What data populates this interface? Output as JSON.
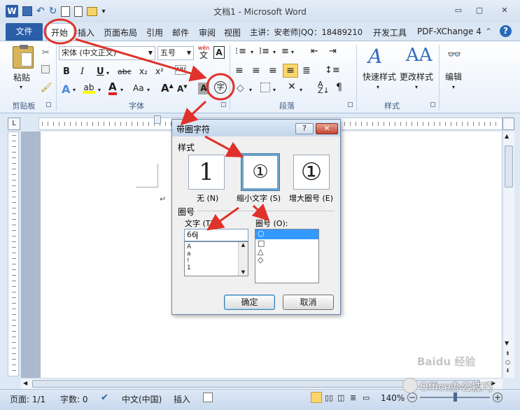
{
  "window": {
    "title": "文档1 - Microsoft Word",
    "app_icon": "W",
    "minimize": "▭",
    "maximize": "▢",
    "close": "✕"
  },
  "tabs": {
    "file": "文件",
    "items": [
      "开始",
      "插入",
      "页面布局",
      "引用",
      "邮件",
      "审阅",
      "视图",
      "主讲：安老师|QQ：18489210",
      "开发工具",
      "PDF-XChange 4"
    ]
  },
  "ribbon": {
    "clipboard": {
      "paste": "粘贴",
      "label": "剪贴板"
    },
    "font": {
      "font_name": "宋体 (中文正文)",
      "font_size": "五号",
      "wen": "wén",
      "bold": "B",
      "italic": "I",
      "underline": "U",
      "strike": "abc",
      "sub": "x₂",
      "sup": "x²",
      "grow": "A",
      "shrink": "A",
      "aa": "Aa",
      "circle_char": "字",
      "label": "字体"
    },
    "paragraph": {
      "label": "段落"
    },
    "styles": {
      "quick": "快速样式",
      "change": "更改样式",
      "label": "样式"
    },
    "editing": {
      "label": "编辑"
    }
  },
  "dialog": {
    "title": "带圈字符",
    "help": "?",
    "close": "✕",
    "style_section": "样式",
    "style_options": [
      {
        "glyph": "1",
        "label": "无 (N)"
      },
      {
        "glyph": "①",
        "label": "缩小文字 (S)"
      },
      {
        "glyph": "①",
        "label": "增大圈号 (E)"
      }
    ],
    "circle_section": "圈号",
    "text_label": "文字 (T):",
    "text_value": "66",
    "text_list": [
      "A",
      "a",
      "!",
      "1"
    ],
    "shape_label": "圈号 (O):",
    "shape_list": [
      "○",
      "□",
      "△",
      "◇"
    ],
    "ok": "确定",
    "cancel": "取消"
  },
  "status": {
    "page": "页面: 1/1",
    "words": "字数: 0",
    "language": "中文(中国)",
    "insert_mode": "插入",
    "zoom": "140%"
  },
  "watermark": {
    "baidu": "Baidu 经验",
    "channel": "Office办公技巧"
  },
  "colors": {
    "accent": "#2a5ea8",
    "annotation": "#e0312b"
  }
}
